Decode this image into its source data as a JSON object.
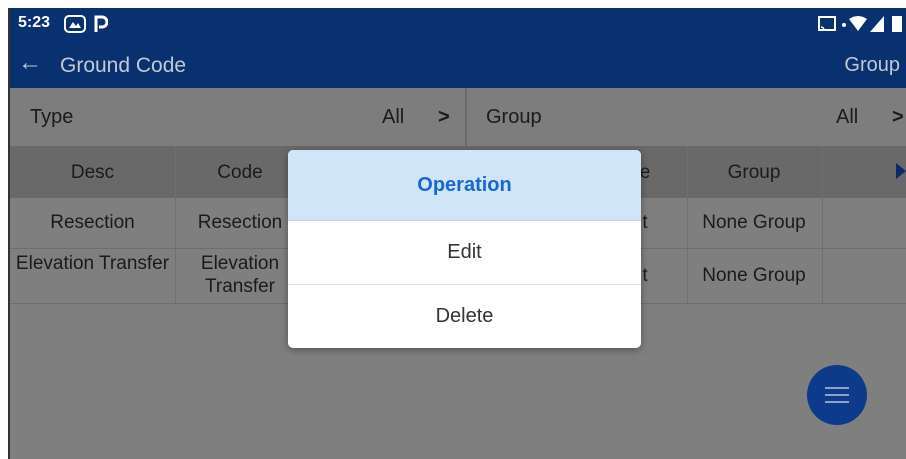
{
  "status_bar": {
    "time": "5:23",
    "icons": [
      "photos-icon",
      "parking-icon",
      "cast-icon",
      "wifi-icon",
      "signal-icon",
      "battery-icon"
    ]
  },
  "app_bar": {
    "title": "Ground Code",
    "right_action": "Group"
  },
  "filters": {
    "type_label": "Type",
    "type_value": "All",
    "group_label": "Group",
    "group_value": "All"
  },
  "table": {
    "headers": [
      "Desc",
      "Code",
      "e",
      "Group"
    ],
    "rows": [
      {
        "desc": "Resection",
        "code": "Resection",
        "partial": "t",
        "group": "None Group"
      },
      {
        "desc": "Elevation Transfer",
        "code": "Elevation Transfer",
        "partial": "t",
        "group": "None Group"
      }
    ]
  },
  "dialog": {
    "title": "Operation",
    "options": [
      "Edit",
      "Delete"
    ]
  },
  "fab": {
    "icon": "menu-icon"
  },
  "colors": {
    "appbar": "#09306f",
    "dialog_header_bg": "#d1e5f8",
    "dialog_title": "#1669d4",
    "fab": "#0d3a8a"
  }
}
